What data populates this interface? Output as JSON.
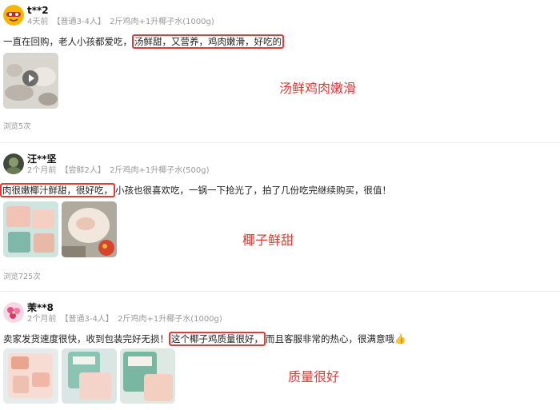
{
  "reviews": [
    {
      "user": "t**2",
      "time": "4天前",
      "tag": "【普通3-4人】",
      "spec": "2斤鸡肉+1升椰子水(1000g)",
      "text_before": "一直在回购，老人小孩都爱吃，",
      "text_highlight": "汤鲜甜，又营养，鸡肉嫩滑，好吃的",
      "text_after": "",
      "views": "浏览5次",
      "annotation": "汤鲜鸡肉嫩滑",
      "media": [
        {
          "type": "video",
          "icon": "play-icon"
        }
      ]
    },
    {
      "user": "汪**坚",
      "time": "2个月前",
      "tag": "【尝鲜2人】",
      "spec": "2斤鸡肉+1升椰子水(500g)",
      "text_before": "",
      "text_highlight": "肉很嫩椰汁鲜甜，很好吃，",
      "text_after": "小孩也很喜欢吃，一锅一下抢光了，拍了几份吃完继续购买，很值！",
      "views": "浏览725次",
      "annotation": "椰子鲜甜",
      "media": [
        {
          "type": "image"
        },
        {
          "type": "image"
        }
      ]
    },
    {
      "user": "茉**8",
      "time": "2个月前",
      "tag": "【普通3-4人】",
      "spec": "2斤鸡肉+1升椰子水(1000g)",
      "text_before": "卖家发货速度很快，收到包装完好无损！",
      "text_highlight": "这个椰子鸡质量很好，",
      "text_after": "而且客服非常的热心，很满意哦",
      "emoji": "👍",
      "annotation": "质量很好",
      "media": [
        {
          "type": "image"
        },
        {
          "type": "image"
        },
        {
          "type": "image"
        }
      ]
    }
  ],
  "colors": {
    "highlight": "#e53935",
    "meta": "#999999"
  }
}
